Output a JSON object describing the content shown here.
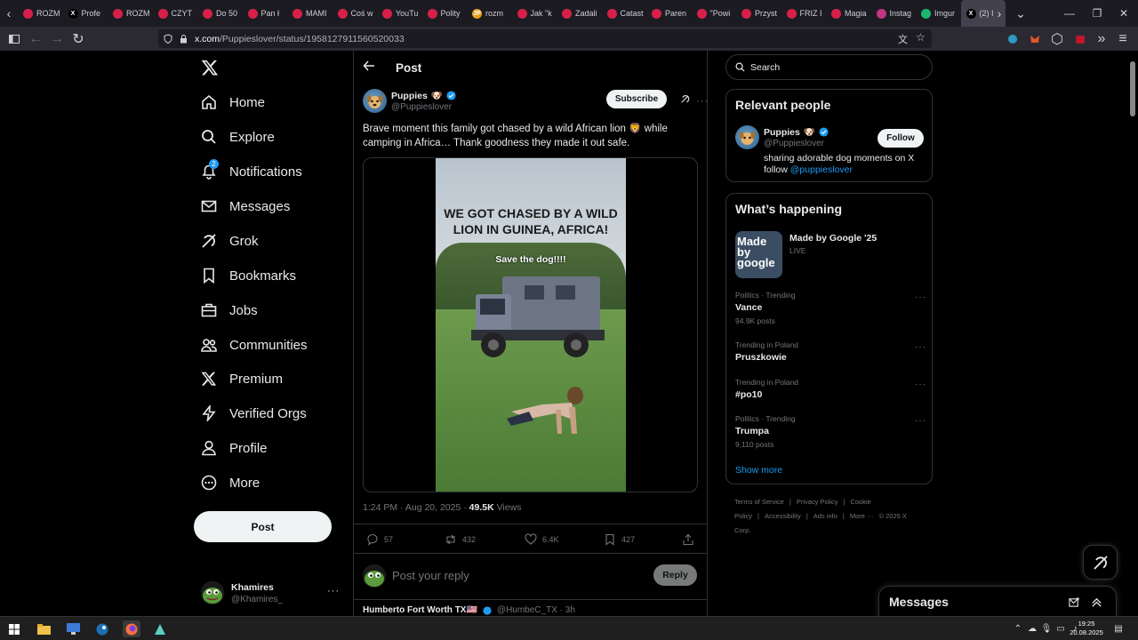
{
  "browser": {
    "tabs": [
      {
        "label": "ROZM",
        "color": "#d6204a"
      },
      {
        "label": "Profe",
        "color": "#000000",
        "glyph": "X"
      },
      {
        "label": "ROZM",
        "color": "#d6204a"
      },
      {
        "label": "CZYT",
        "color": "#d6204a"
      },
      {
        "label": "Do 50",
        "color": "#d6204a"
      },
      {
        "label": "Pan ł",
        "color": "#d6204a"
      },
      {
        "label": "MAMI",
        "color": "#d6204a"
      },
      {
        "label": "Coś w",
        "color": "#d6204a"
      },
      {
        "label": "YouTu",
        "color": "#d6204a"
      },
      {
        "label": "Polity",
        "color": "#d6204a"
      },
      {
        "label": "rozm",
        "color": "#e8a01a",
        "glyph": "JP"
      },
      {
        "label": "Jak \"k",
        "color": "#d6204a"
      },
      {
        "label": "Zadali",
        "color": "#d6204a"
      },
      {
        "label": "Catast",
        "color": "#d6204a"
      },
      {
        "label": "Paren",
        "color": "#d6204a"
      },
      {
        "label": "\"Powi",
        "color": "#d6204a"
      },
      {
        "label": "Przyst",
        "color": "#d6204a"
      },
      {
        "label": "FRIZ I",
        "color": "#d6204a"
      },
      {
        "label": "Magia",
        "color": "#d6204a"
      },
      {
        "label": "Instag",
        "color": "#c13584"
      },
      {
        "label": "Imgur",
        "color": "#1bb76e"
      },
      {
        "label": "(2) I",
        "color": "#000000",
        "glyph": "X",
        "active": true
      }
    ],
    "url_host": "x.com",
    "url_path": "/Puppieslover/status/1958127911560520033"
  },
  "nav": {
    "items": [
      {
        "label": "Home",
        "icon": "home-icon"
      },
      {
        "label": "Explore",
        "icon": "search-icon"
      },
      {
        "label": "Notifications",
        "icon": "bell-icon",
        "badge": "2"
      },
      {
        "label": "Messages",
        "icon": "envelope-icon"
      },
      {
        "label": "Grok",
        "icon": "grok-icon"
      },
      {
        "label": "Bookmarks",
        "icon": "bookmark-icon"
      },
      {
        "label": "Jobs",
        "icon": "briefcase-icon"
      },
      {
        "label": "Communities",
        "icon": "people-icon"
      },
      {
        "label": "Premium",
        "icon": "x-logo-icon"
      },
      {
        "label": "Verified Orgs",
        "icon": "lightning-icon"
      },
      {
        "label": "Profile",
        "icon": "person-icon"
      },
      {
        "label": "More",
        "icon": "more-circle-icon"
      }
    ],
    "post_button": "Post",
    "account": {
      "name": "Khamires",
      "handle": "@Khamires_"
    }
  },
  "post": {
    "header_title": "Post",
    "author_name": "Puppies",
    "author_emoji": "🐶",
    "author_handle": "@Puppieslover",
    "subscribe_label": "Subscribe",
    "text": "Brave moment this family got chased by a wild African lion 🦁 while camping in Africa… Thank goodness they made it out safe.",
    "video_caption": "WE GOT CHASED BY A WILD LION IN GUINEA, AFRICA!",
    "video_subcaption": "Save the dog!!!!",
    "time": "1:24 PM · Aug 20, 2025 · ",
    "views_count": "49.5K",
    "views_label": " Views",
    "replies": "57",
    "reposts": "432",
    "likes": "6.4K",
    "bookmarks": "427",
    "reply_placeholder": "Post your reply",
    "reply_button": "Reply",
    "next_reply_name": "Humberto Fort Worth TX🇺🇸",
    "next_reply_handle": "@HumbeC_TX · 3h"
  },
  "right": {
    "search_placeholder": "Search",
    "relevant_title": "Relevant people",
    "person_name": "Puppies",
    "person_emoji": "🐶",
    "person_handle": "@Puppieslover",
    "follow_label": "Follow",
    "bio_text": "sharing adorable dog moments on X follow ",
    "bio_link": "@puppieslover",
    "happening_title": "What’s happening",
    "event_title": "Made by Google '25",
    "event_status": "LIVE",
    "event_thumb_text": "Made by google",
    "trends": [
      {
        "category": "Politics · Trending",
        "topic": "Vance",
        "count": "94.9K posts"
      },
      {
        "category": "Trending in Poland",
        "topic": "Pruszkowie",
        "count": ""
      },
      {
        "category": "Trending in Poland",
        "topic": "#po10",
        "count": ""
      },
      {
        "category": "Politics · Trending",
        "topic": "Trumpa",
        "count": "9,110 posts"
      }
    ],
    "show_more": "Show more",
    "footer_links": [
      "Terms of Service",
      "|",
      "Privacy Policy",
      "|",
      "Cookie Policy",
      "|",
      "Accessibility",
      "|",
      "Ads info",
      "|",
      "More ···",
      "© 2025 X Corp."
    ]
  },
  "messages_dock": {
    "title": "Messages"
  },
  "taskbar": {
    "time": "19:25",
    "date": "20.08.2025"
  }
}
